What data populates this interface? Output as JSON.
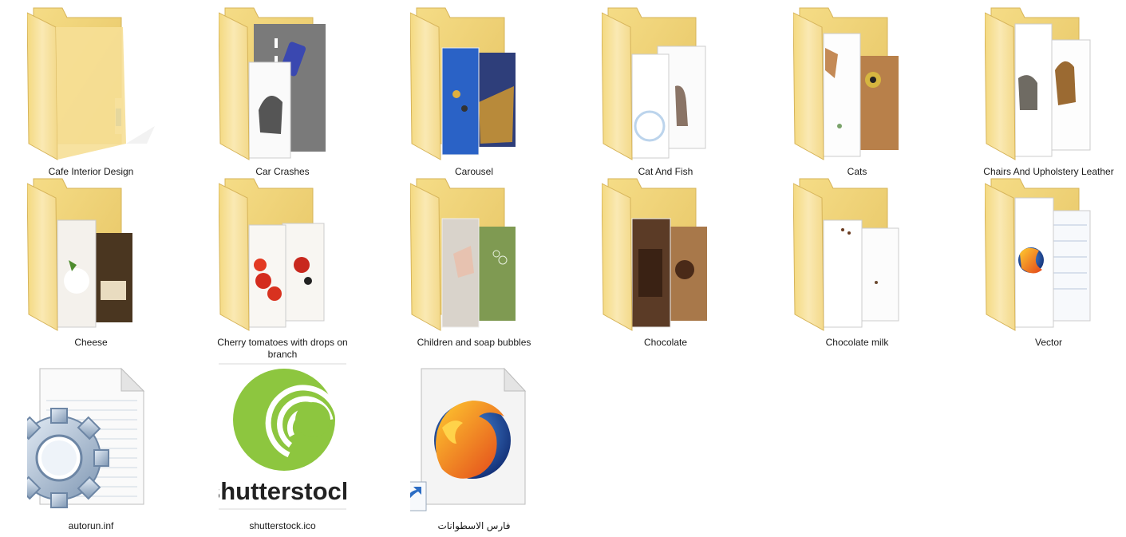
{
  "window": {
    "view": "Large icons"
  },
  "items": [
    {
      "name": "Cafe Interior Design",
      "type": "folder",
      "icon": "empty-folder-icon"
    },
    {
      "name": "Car Crashes",
      "type": "folder",
      "icon": "folder-car-crashes-icon"
    },
    {
      "name": "Carousel",
      "type": "folder",
      "icon": "folder-carousel-icon"
    },
    {
      "name": "Cat And Fish",
      "type": "folder",
      "icon": "folder-cat-and-fish-icon"
    },
    {
      "name": "Cats",
      "type": "folder",
      "icon": "folder-cats-icon"
    },
    {
      "name": "Chairs And Upholstery Leather",
      "type": "folder",
      "icon": "folder-chairs-icon"
    },
    {
      "name": "Cheese",
      "type": "folder",
      "icon": "folder-cheese-icon"
    },
    {
      "name": "Cherry tomatoes with drops on branch",
      "type": "folder",
      "icon": "folder-tomatoes-icon"
    },
    {
      "name": "Children and soap bubbles",
      "type": "folder",
      "icon": "folder-bubbles-icon"
    },
    {
      "name": "Chocolate",
      "type": "folder",
      "icon": "folder-chocolate-icon"
    },
    {
      "name": "Chocolate milk",
      "type": "folder",
      "icon": "folder-chocolate-milk-icon"
    },
    {
      "name": "Vector",
      "type": "folder",
      "icon": "folder-vector-icon"
    },
    {
      "name": "autorun.inf",
      "type": "file",
      "icon": "settings-file-gear-icon"
    },
    {
      "name": "shutterstock.ico",
      "type": "file",
      "icon": "shutterstock-logo-icon",
      "logo_text": "shutterstock"
    },
    {
      "name": "فارس الاسطوانات",
      "type": "shortcut",
      "icon": "firefox-shortcut-icon"
    }
  ],
  "colors": {
    "folder_back": "#f2d77c",
    "folder_front": "#f7e3a1",
    "shutterstock_green": "#8dc63f",
    "firefox_orange": "#e8670c",
    "firefox_blue": "#1f4b9c",
    "shortcut_blue": "#2b6cc4"
  }
}
